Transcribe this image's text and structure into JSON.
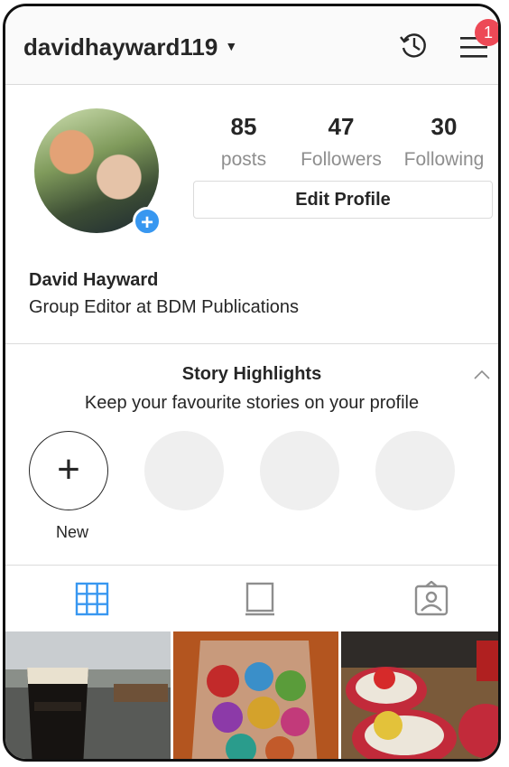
{
  "header": {
    "username": "davidhayward119",
    "caret_icon": "caret-down-icon",
    "history_icon": "history-icon",
    "menu_icon": "hamburger-menu-icon",
    "notification_count": "1"
  },
  "profile": {
    "stats": [
      {
        "value": "85",
        "label": "posts"
      },
      {
        "value": "47",
        "label": "Followers"
      },
      {
        "value": "30",
        "label": "Following"
      }
    ],
    "edit_button": "Edit Profile",
    "name": "David Hayward",
    "bio": "Group Editor at BDM Publications"
  },
  "highlights": {
    "title": "Story Highlights",
    "subtitle": "Keep your favourite stories on your profile",
    "new_label": "New"
  },
  "tabs": [
    {
      "icon": "grid-icon",
      "active": true
    },
    {
      "icon": "igtv-icon",
      "active": false
    },
    {
      "icon": "tagged-icon",
      "active": false
    }
  ],
  "colors": {
    "accent": "#3897f0",
    "badge": "#ed4956",
    "muted_text": "#8e8e8e",
    "border": "#dbdbdb"
  }
}
